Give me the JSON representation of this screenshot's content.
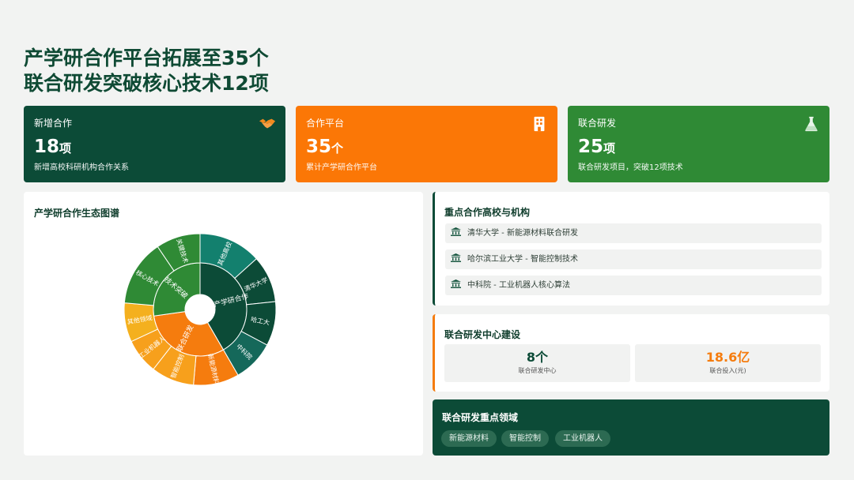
{
  "title": {
    "line1": "产学研合作平台拓展至35个",
    "line2": "联合研发突破核心技术12项"
  },
  "stats": [
    {
      "label": "新增合作",
      "value": "18",
      "unit": "项",
      "desc": "新增高校科研机构合作关系",
      "icon": "handshake-icon",
      "color": "#0c4b37"
    },
    {
      "label": "合作平台",
      "value": "35",
      "unit": "个",
      "desc": "累计产学研合作平台",
      "icon": "building-icon",
      "color": "#fb7706"
    },
    {
      "label": "联合研发",
      "value": "25",
      "unit": "项",
      "desc": "联合研发项目，突破12项技术",
      "icon": "flask-icon",
      "color": "#2f8a35"
    }
  ],
  "ecosystem": {
    "title": "产学研合作生态图谱",
    "center_label": "",
    "inner": [
      {
        "label": "产学研合作",
        "color": "#0c4b37"
      },
      {
        "label": "联合研发",
        "color": "#f57c0e"
      },
      {
        "label": "技术突破",
        "color": "#2f8a35"
      }
    ],
    "outer": [
      {
        "label": "其他高校",
        "color": "#13806e"
      },
      {
        "label": "清华大学",
        "color": "#0c4b37"
      },
      {
        "label": "哈工大",
        "color": "#0c4b37"
      },
      {
        "label": "中科院",
        "color": "#15685a"
      },
      {
        "label": "新能源材料",
        "color": "#f57c0e"
      },
      {
        "label": "智能控制",
        "color": "#f7a01c"
      },
      {
        "label": "工业机器人",
        "color": "#f7a01c"
      },
      {
        "label": "其他领域",
        "color": "#f4b01e"
      },
      {
        "label": "核心技术",
        "color": "#2f8a35"
      },
      {
        "label": "关键技术",
        "color": "#2f8a35"
      }
    ]
  },
  "partners": {
    "title": "重点合作高校与机构",
    "items": [
      "清华大学 - 新能源材料联合研发",
      "哈尔滨工业大学 - 智能控制技术",
      "中科院 - 工业机器人核心算法"
    ]
  },
  "center": {
    "title": "联合研发中心建设",
    "metrics": [
      {
        "value": "8个",
        "label": "联合研发中心",
        "color": "#0c4b37"
      },
      {
        "value": "18.6亿",
        "label": "联合投入(元)",
        "color": "#f57c0e"
      }
    ]
  },
  "fields": {
    "title": "联合研发重点领域",
    "tags": [
      "新能源材料",
      "智能控制",
      "工业机器人"
    ]
  },
  "colors": {
    "dark_green": "#0c4b37",
    "orange": "#fb7706",
    "green": "#2f8a35",
    "background": "#f2f3f2"
  }
}
